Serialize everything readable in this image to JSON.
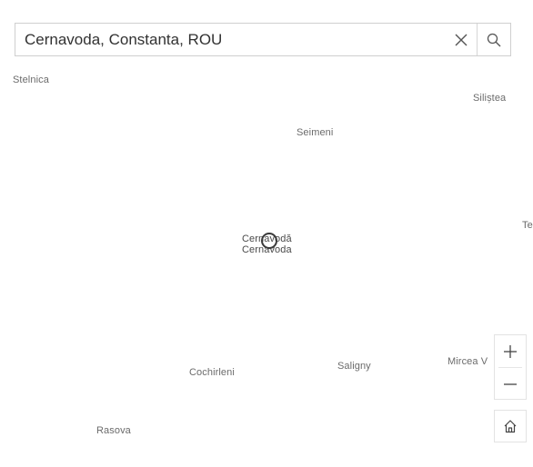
{
  "search": {
    "value": "Cernavoda, Constanta, ROU"
  },
  "icons": {
    "clear": "close-icon",
    "search": "search-icon",
    "zoom_in": "plus-icon",
    "zoom_out": "minus-icon",
    "home": "home-icon",
    "marker": "location-circle-icon"
  },
  "places": {
    "stelnica": "Stelnica",
    "silistea": "Siliștea",
    "seimeni": "Seimeni",
    "te": "Te",
    "cernavoda_1": "Cernavodă",
    "cernavoda_2": "Cernavoda",
    "cochirleni": "Cochirleni",
    "saligny": "Saligny",
    "mircea": "Mircea V",
    "rasova": "Rasova"
  }
}
